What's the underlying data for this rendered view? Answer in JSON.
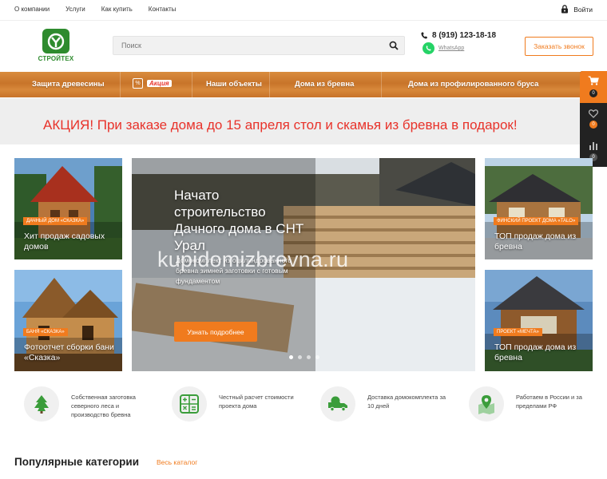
{
  "topbar": {
    "menu": [
      "О компании",
      "Услуги",
      "Как купить",
      "Контакты"
    ],
    "login_label": "Войти"
  },
  "header": {
    "logo_text": "СТРОЙТЕХ",
    "search_placeholder": "Поиск",
    "phone": "8 (919) 123-18-18",
    "whatsapp_label": "WhatsApp",
    "callback_label": "Заказать звонок"
  },
  "nav": {
    "items": [
      "Защита древесины",
      "Акция",
      "Наши объекты",
      "Дома из бревна",
      "Дома из профилированного бруса"
    ]
  },
  "side_panel": {
    "cart_count": "0",
    "favorites_count": "0",
    "compare_count": "0"
  },
  "banner": {
    "text": "АКЦИЯ! При заказе дома до 15 апреля стол и скамья из бревна в подарок!"
  },
  "cards": [
    {
      "tag": "Дачный дом «Сказка»",
      "title": "Хит продаж садовых домов"
    },
    {
      "tag": "Баня «Сказка»",
      "title": "Фотоотчет сборки бани «Сказка»"
    },
    {
      "tag": "Финский проект дома «TALO»",
      "title": "ТОП продаж дома из бревна"
    },
    {
      "tag": "Проект «Мечта»",
      "title": "ТОП продаж дома из бревна"
    }
  ],
  "slider": {
    "title": "Начато строительство Дачного дома в СНТ Урал",
    "description": "Домокомплект из оцилиндрованного бревна зимней заготовки с готовым фундаментом",
    "button_label": "Узнать подробнее",
    "watermark": "kupidomizbrevna.ru",
    "slides_total": 4,
    "active_slide": 1
  },
  "features": [
    {
      "icon": "tree-icon",
      "text": "Собственная заготовка северного леса и производство бревна"
    },
    {
      "icon": "calculator-icon",
      "text": "Честный расчет стоимости проекта дома"
    },
    {
      "icon": "truck-icon",
      "text": "Доставка домокомплекта за 10 дней"
    },
    {
      "icon": "map-pin-icon",
      "text": "Работаем в России и за пределами РФ"
    }
  ],
  "popular": {
    "title": "Популярные категории",
    "catalog_link": "Весь каталог"
  },
  "colors": {
    "accent": "#f07b1e",
    "brand": "#2e8b2e",
    "promo": "#e8322a"
  }
}
